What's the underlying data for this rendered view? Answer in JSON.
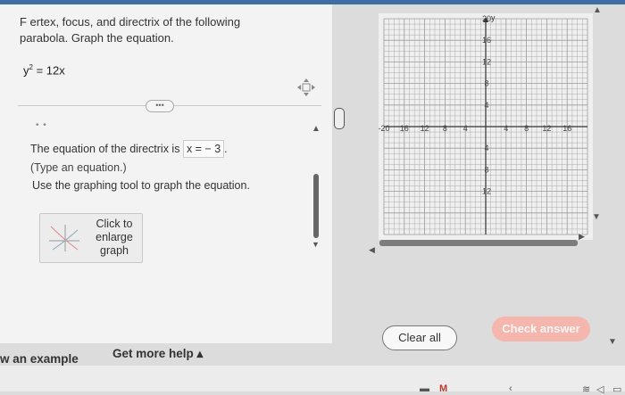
{
  "question": {
    "line1": "F   ertex, focus, and directrix of the following",
    "line2": "parabola. Graph the equation.",
    "equation_lhs": "y",
    "equation_exp": "2",
    "equation_rhs": "= 12x"
  },
  "expand_button": "•••",
  "small_dots": "• •",
  "answer": {
    "prefix": "The equation of the directrix is",
    "value": "x = − 3",
    "suffix": ".",
    "hint": "(Type an equation.)"
  },
  "instruction": "Use the graphing tool to graph the equation.",
  "enlarge": {
    "line1": "Click to",
    "line2": "enlarge",
    "line3": "graph"
  },
  "graph": {
    "x_min": -20,
    "x_max": 20,
    "y_min": -20,
    "y_max": 20,
    "y_axis_label": "y",
    "x_ticks": [
      {
        "v": -20,
        "t": "-20"
      },
      {
        "v": -16,
        "t": "16"
      },
      {
        "v": -12,
        "t": "12"
      },
      {
        "v": -8,
        "t": "8"
      },
      {
        "v": -4,
        "t": "4"
      },
      {
        "v": 4,
        "t": "4"
      },
      {
        "v": 8,
        "t": "8"
      },
      {
        "v": 12,
        "t": "12"
      },
      {
        "v": 16,
        "t": "16"
      }
    ],
    "y_ticks": [
      {
        "v": 20,
        "t": "20"
      },
      {
        "v": 16,
        "t": "16"
      },
      {
        "v": 12,
        "t": "12"
      },
      {
        "v": 8,
        "t": "8"
      },
      {
        "v": 4,
        "t": "4"
      },
      {
        "v": -4,
        "t": "4"
      },
      {
        "v": -8,
        "t": "8"
      },
      {
        "v": -12,
        "t": "12"
      }
    ]
  },
  "buttons": {
    "clear_all": "Clear all",
    "check_answer": "Check answer"
  },
  "footer": {
    "example": "w an example",
    "help": "Get more help ▴"
  },
  "colors": {
    "accent": "#3d6fa3",
    "check_button": "#f4b6ad",
    "grid_line": "#9a9a9a",
    "grid_bg": "#efefef"
  }
}
